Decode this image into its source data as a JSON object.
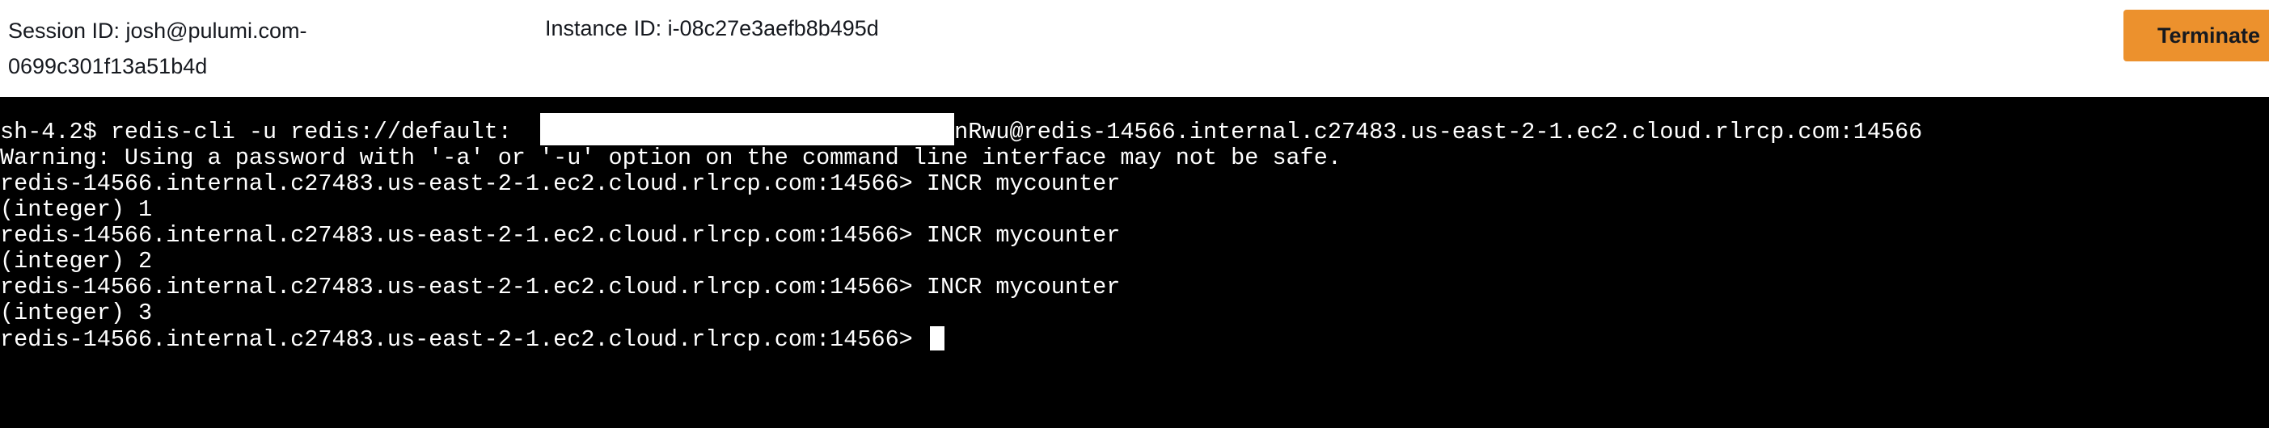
{
  "header": {
    "session_id": "Session ID: josh@pulumi.com-0699c301f13a51b4d",
    "instance_id": "Instance ID: i-08c27e3aefb8b495d",
    "terminate_label": "Terminate"
  },
  "terminal": {
    "lines": [
      "sh-4.2$ redis-cli -u redis://default:                                nRwu@redis-14566.internal.c27483.us-east-2-1.ec2.cloud.rlrcp.com:14566",
      "Warning: Using a password with '-a' or '-u' option on the command line interface may not be safe.",
      "redis-14566.internal.c27483.us-east-2-1.ec2.cloud.rlrcp.com:14566> INCR mycounter",
      "(integer) 1",
      "redis-14566.internal.c27483.us-east-2-1.ec2.cloud.rlrcp.com:14566> INCR mycounter",
      "(integer) 2",
      "redis-14566.internal.c27483.us-east-2-1.ec2.cloud.rlrcp.com:14566> INCR mycounter",
      "(integer) 3"
    ],
    "prompt": "redis-14566.internal.c27483.us-east-2-1.ec2.cloud.rlrcp.com:14566> "
  }
}
